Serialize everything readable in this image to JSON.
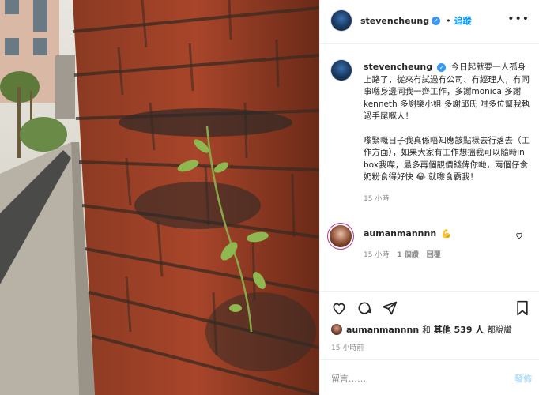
{
  "header": {
    "username": "stevencheung",
    "separator": "•",
    "follow_label": "追蹤",
    "more_label": "•••"
  },
  "caption": {
    "username": "stevencheung",
    "paragraph1": "今日起就要一人孤身上路了，從來冇試過冇公司、冇經理人，冇同事喺身邊同我一齊工作，多謝monica 多謝kenneth 多謝樂小姐 多謝邱氏 咁多位幫我執過手尾嘅人！",
    "paragraph2": "嚟緊嘅日子我真係唔知應該點樣去行落去（工作方面），如果大家有工作想搵我可以隨時in box我㗎，最多再個靚價錢俾你哋，兩個仔食奶粉食得好快 😂 就嚟食霸我！",
    "time": "15 小時"
  },
  "comment": {
    "username": "aumanmannnn",
    "emoji": "💪",
    "time": "15 小時",
    "likes": "1 個讚",
    "reply": "回覆"
  },
  "likes": {
    "username": "aumanmannnn",
    "connector": "和",
    "others": "其他 539 人",
    "suffix": "都說讚"
  },
  "post_time": "15 小時前",
  "comment_input": {
    "placeholder": "留言……",
    "post_label": "發佈"
  },
  "icons": {
    "like": "heart-icon",
    "comment": "comment-icon",
    "share": "share-icon",
    "save": "bookmark-icon",
    "verified": "verified-icon"
  },
  "colors": {
    "accent": "#0095f6",
    "verified": "#3897f0",
    "muted": "#8e8e8e"
  }
}
